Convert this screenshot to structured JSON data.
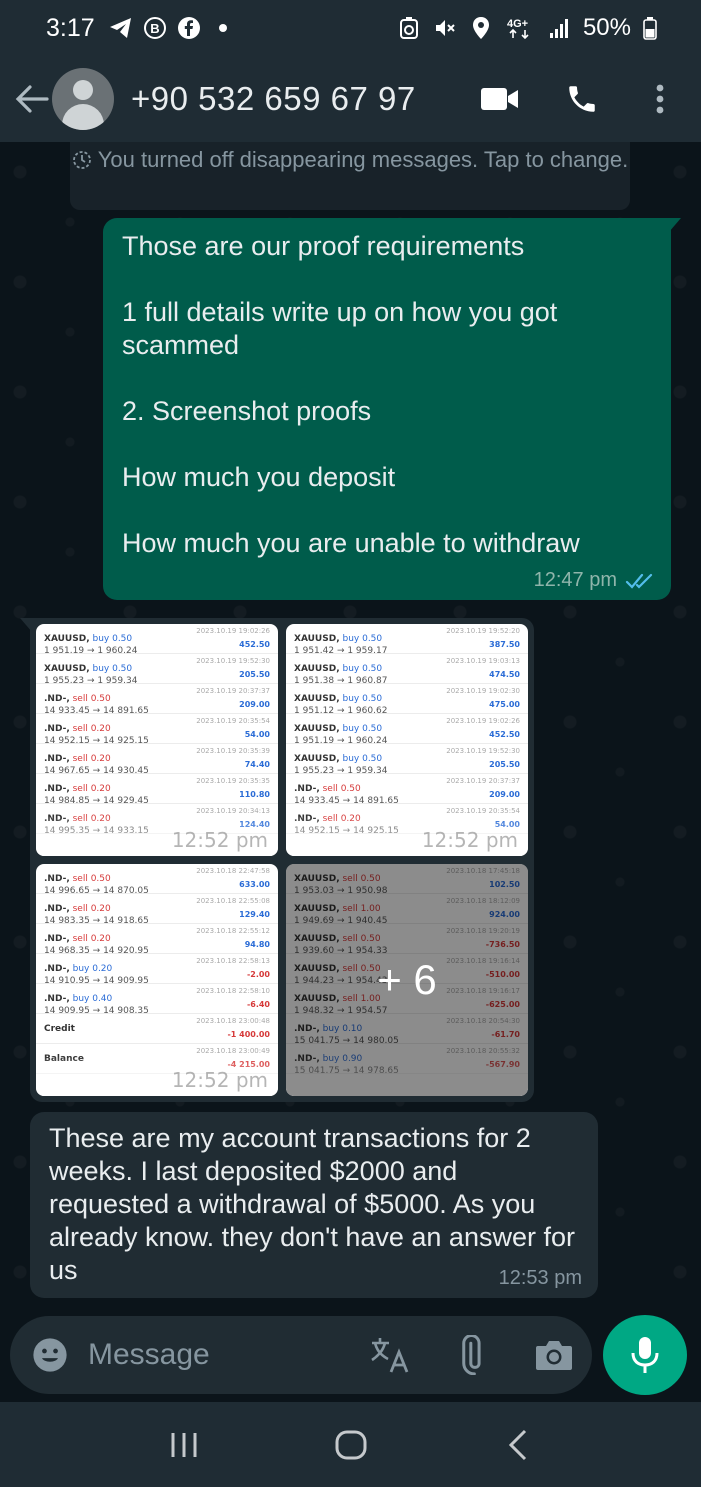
{
  "status_bar": {
    "time": "3:17",
    "battery": "50%",
    "network": "4G+",
    "icons": [
      "telegram-icon",
      "b-circle-icon",
      "facebook-icon",
      "dot-icon",
      "recycle-icon",
      "mute-icon",
      "location-icon",
      "4g-icon",
      "signal-icon",
      "battery-icon"
    ]
  },
  "header": {
    "contact": "+90 532 659 67 97",
    "icons": [
      "back-arrow-icon",
      "avatar-icon",
      "video-call-icon",
      "phone-icon",
      "more-vert-icon"
    ]
  },
  "system_message": "You turned off disappearing messages. Tap to change.",
  "outgoing": {
    "lines": [
      "Those are our proof requirements",
      "",
      "1 full details write up on how you got scammed",
      "",
      "2. Screenshot proofs",
      "",
      "How much you deposit",
      "",
      "How much you are unable to withdraw"
    ],
    "time": "12:47 pm",
    "status": "read",
    "accent": "#53bdeb"
  },
  "album": {
    "more_label": "+ 6",
    "time": "12:52 pm",
    "thumbs": [
      {
        "rows": [
          {
            "sym": "XAUUSD,",
            "side": "buy 0.50",
            "px": "1 951.19 → 1 960.24",
            "dt": "2023.10.19 19:02:26",
            "pr": "452.50"
          },
          {
            "sym": "XAUUSD,",
            "side": "buy 0.50",
            "px": "1 955.23 → 1 959.34",
            "dt": "2023.10.19 19:52:30",
            "pr": "205.50"
          },
          {
            "sym": ".ND-,",
            "side": "sell 0.50",
            "px": "14 933.45 → 14 891.65",
            "dt": "2023.10.19 20:37:37",
            "pr": "209.00"
          },
          {
            "sym": ".ND-,",
            "side": "sell 0.20",
            "px": "14 952.15 → 14 925.15",
            "dt": "2023.10.19 20:35:54",
            "pr": "54.00"
          },
          {
            "sym": ".ND-,",
            "side": "sell 0.20",
            "px": "14 967.65 → 14 930.45",
            "dt": "2023.10.19 20:35:39",
            "pr": "74.40"
          },
          {
            "sym": ".ND-,",
            "side": "sell 0.20",
            "px": "14 984.85 → 14 929.45",
            "dt": "2023.10.19 20:35:35",
            "pr": "110.80"
          },
          {
            "sym": ".ND-,",
            "side": "sell 0.20",
            "px": "14 995.35 → 14 933.15",
            "dt": "2023.10.19 20:34:13",
            "pr": "124.40"
          }
        ]
      },
      {
        "rows": [
          {
            "sym": "XAUUSD,",
            "side": "buy 0.50",
            "px": "1 951.42 → 1 959.17",
            "dt": "2023.10.19 19:52:20",
            "pr": "387.50"
          },
          {
            "sym": "XAUUSD,",
            "side": "buy 0.50",
            "px": "1 951.38 → 1 960.87",
            "dt": "2023.10.19 19:03:13",
            "pr": "474.50"
          },
          {
            "sym": "XAUUSD,",
            "side": "buy 0.50",
            "px": "1 951.12 → 1 960.62",
            "dt": "2023.10.19 19:02:30",
            "pr": "475.00"
          },
          {
            "sym": "XAUUSD,",
            "side": "buy 0.50",
            "px": "1 951.19 → 1 960.24",
            "dt": "2023.10.19 19:02:26",
            "pr": "452.50"
          },
          {
            "sym": "XAUUSD,",
            "side": "buy 0.50",
            "px": "1 955.23 → 1 959.34",
            "dt": "2023.10.19 19:52:30",
            "pr": "205.50"
          },
          {
            "sym": ".ND-,",
            "side": "sell 0.50",
            "px": "14 933.45 → 14 891.65",
            "dt": "2023.10.19 20:37:37",
            "pr": "209.00"
          },
          {
            "sym": ".ND-,",
            "side": "sell 0.20",
            "px": "14 952.15 → 14 925.15",
            "dt": "2023.10.19 20:35:54",
            "pr": "54.00"
          }
        ]
      },
      {
        "rows": [
          {
            "sym": ".ND-,",
            "side": "sell 0.50",
            "px": "14 996.65 → 14 870.05",
            "dt": "2023.10.18 22:47:58",
            "pr": "633.00"
          },
          {
            "sym": ".ND-,",
            "side": "sell 0.20",
            "px": "14 983.35 → 14 918.65",
            "dt": "2023.10.18 22:55:08",
            "pr": "129.40"
          },
          {
            "sym": ".ND-,",
            "side": "sell 0.20",
            "px": "14 968.35 → 14 920.95",
            "dt": "2023.10.18 22:55:12",
            "pr": "94.80"
          },
          {
            "sym": ".ND-,",
            "side": "buy 0.20",
            "px": "14 910.95 → 14 909.95",
            "dt": "2023.10.18 22:58:13",
            "pr": "-2.00"
          },
          {
            "sym": ".ND-,",
            "side": "buy 0.40",
            "px": "14 909.95 → 14 908.35",
            "dt": "2023.10.18 22:58:10",
            "pr": "-6.40"
          },
          {
            "sym": "Credit",
            "side": "",
            "px": "",
            "dt": "2023.10.18 23:00:48",
            "pr": "-1 400.00"
          },
          {
            "sym": "Balance",
            "side": "",
            "px": "",
            "dt": "2023.10.18 23:00:49",
            "pr": "-4 215.00"
          }
        ]
      },
      {
        "rows": [
          {
            "sym": "XAUUSD,",
            "side": "sell 0.50",
            "px": "1 953.03 → 1 950.98",
            "dt": "2023.10.18 17:45:18",
            "pr": "102.50"
          },
          {
            "sym": "XAUUSD,",
            "side": "sell 1.00",
            "px": "1 949.69 → 1 940.45",
            "dt": "2023.10.18 18:12:09",
            "pr": "924.00"
          },
          {
            "sym": "XAUUSD,",
            "side": "sell 0.50",
            "px": "1 939.60 → 1 954.33",
            "dt": "2023.10.18 19:20:19",
            "pr": "-736.50"
          },
          {
            "sym": "XAUUSD,",
            "side": "sell 0.50",
            "px": "1 944.23 → 1 954.43",
            "dt": "2023.10.18 19:16:14",
            "pr": "-510.00"
          },
          {
            "sym": "XAUUSD,",
            "side": "sell 1.00",
            "px": "1 948.32 → 1 954.57",
            "dt": "2023.10.18 19:16:17",
            "pr": "-625.00"
          },
          {
            "sym": ".ND-,",
            "side": "buy 0.10",
            "px": "15 041.75 → 14 980.05",
            "dt": "2023.10.18 20:54:30",
            "pr": "-61.70"
          },
          {
            "sym": ".ND-,",
            "side": "buy 0.90",
            "px": "15 041.75 → 14 978.65",
            "dt": "2023.10.18 20:55:32",
            "pr": "-567.90"
          }
        ]
      }
    ]
  },
  "incoming": {
    "text": "These are my account transactions for 2 weeks. I last deposited $2000 and requested a withdrawal of $5000. As you already know. they don't have an answer for us",
    "time": "12:53 pm"
  },
  "composer": {
    "placeholder": "Message",
    "icons": [
      "emoji-icon",
      "translate-icon",
      "attach-icon",
      "camera-icon",
      "mic-icon"
    ]
  },
  "nav": {
    "icons": [
      "recents-icon",
      "home-icon",
      "back-icon"
    ]
  },
  "colors": {
    "outgoing_bubble": "#005c4b",
    "incoming_bubble": "#202c33",
    "accent_green": "#00a884",
    "header": "#1f2c34",
    "chat_bg": "#0b141a"
  }
}
